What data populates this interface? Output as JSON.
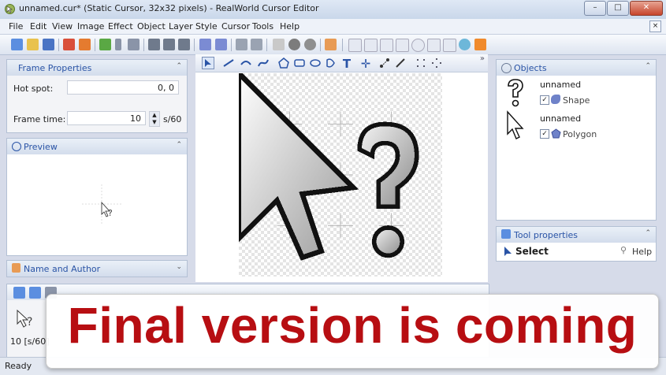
{
  "window": {
    "title": "unnamed.cur* (Static Cursor, 32x32 pixels) - RealWorld Cursor Editor",
    "buttons": [
      "–",
      "□",
      "✕"
    ]
  },
  "menubar": [
    "File",
    "Edit",
    "View",
    "Image",
    "Effect",
    "Object",
    "Layer",
    "Style",
    "Cursor",
    "Tools",
    "Help"
  ],
  "mdi_close": "×",
  "frame_properties": {
    "header": "Frame Properties",
    "hot_spot_label": "Hot spot:",
    "hot_spot_value": "0, 0",
    "frame_time_label": "Frame time:",
    "frame_time_value": "10",
    "frame_time_unit": "s/60"
  },
  "preview": {
    "header": "Preview"
  },
  "name_author": {
    "header": "Name and Author"
  },
  "frames": {
    "frame_label": "10 [s/60]"
  },
  "objects": {
    "header": "Objects",
    "items": [
      {
        "name": "unnamed",
        "type": "Shape",
        "checked": true
      },
      {
        "name": "unnamed",
        "type": "Polygon",
        "checked": true
      }
    ]
  },
  "tool_properties": {
    "header": "Tool properties",
    "tool": "Select",
    "help": "Help"
  },
  "status": {
    "text": "Ready"
  },
  "overlay": {
    "message": "Final version is coming"
  },
  "colors": {
    "accent": "#2a54a6",
    "overlay_text": "#b70e12"
  }
}
